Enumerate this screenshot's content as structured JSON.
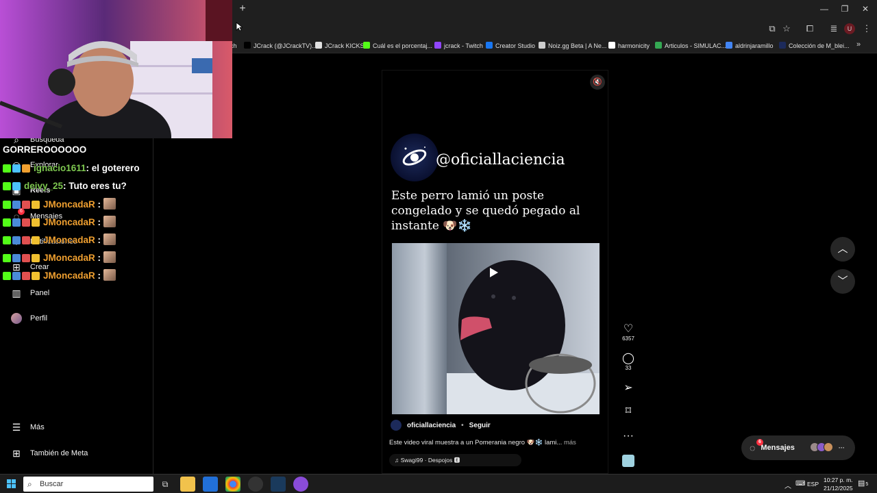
{
  "browser": {
    "new_tab": "+",
    "window": {
      "minimize": "—",
      "restore": "❐",
      "close": "✕"
    },
    "bookmarks": [
      {
        "label": "ch",
        "color": "#1f1f1f"
      },
      {
        "label": "JCrack (@JCrackTV)...",
        "color": "#000000"
      },
      {
        "label": "JCrack KICKS",
        "color": "#e0e0e0"
      },
      {
        "label": "Cuál es el porcentaj...",
        "color": "#53fc18"
      },
      {
        "label": "jcrack - Twitch",
        "color": "#9146ff"
      },
      {
        "label": "Creator Studio",
        "color": "#1877f2"
      },
      {
        "label": "Noiz.gg Beta | A Ne...",
        "color": "#cccccc"
      },
      {
        "label": "harmonicity",
        "color": "#ffffff"
      },
      {
        "label": "Articulos - SIMULAC...",
        "color": "#34a853"
      },
      {
        "label": "aldrinjaramillo",
        "color": "#4285f4"
      },
      {
        "label": "Colección de M_blei...",
        "color": "#1c2a5a"
      }
    ],
    "bookmarks_more": "»"
  },
  "sidebar": {
    "items": [
      {
        "label": "Búsqueda",
        "icon": "search-icon"
      },
      {
        "label": "Explorar",
        "icon": "compass-icon"
      },
      {
        "label": "Reels",
        "icon": "reels-icon"
      },
      {
        "label": "Mensajes",
        "icon": "messenger-icon",
        "badge": "6"
      },
      {
        "label": "Notificaciones",
        "icon": "heart-icon"
      },
      {
        "label": "Crear",
        "icon": "plus-icon"
      },
      {
        "label": "Panel",
        "icon": "chart-icon"
      },
      {
        "label": "Perfil",
        "icon": "avatar"
      }
    ],
    "more": "Más",
    "meta": "También de Meta"
  },
  "stream_chat": {
    "first_line_text": "GORREROOOOOO",
    "lines": [
      {
        "user": "ignacio1611",
        "user_color": "#7ec850",
        "message": ": el goterero"
      },
      {
        "user": "deivy_25",
        "user_color": "#7ec850",
        "message": ": Tuto eres tu?"
      },
      {
        "user": "JMoncadaR",
        "user_color": "#f0a030",
        "message": " :"
      },
      {
        "user": "JMoncadaR",
        "user_color": "#f0a030",
        "message": " :"
      },
      {
        "user": "JMoncadaR",
        "user_color": "#f0a030",
        "message": " :"
      },
      {
        "user": "JMoncadaR",
        "user_color": "#f0a030",
        "message": " :"
      },
      {
        "user": "JMoncadaR",
        "user_color": "#f0a030",
        "message": " :"
      }
    ]
  },
  "reel": {
    "handle_overlay": "@oficiallaciencia",
    "caption_overlay": "Este perro lamió un poste congelado y se quedó pegado al instante 🐶❄️",
    "author": "oficiallaciencia",
    "separator": "•",
    "follow_label": "Seguir",
    "description": "Este video viral muestra a un Pomerania negro 🐶❄️ lami...",
    "more_label": "más",
    "music": "♫ Swagi99 · Despojos 🅴"
  },
  "actions": {
    "likes": "6357",
    "comments": "33"
  },
  "messages_pill": {
    "label": "Mensajes",
    "badge": "6",
    "more": "···"
  },
  "taskbar": {
    "search_placeholder": "Buscar",
    "language": "ESP",
    "time": "10:27 p. m.",
    "date": "21/12/2025",
    "notif_count": "5"
  }
}
